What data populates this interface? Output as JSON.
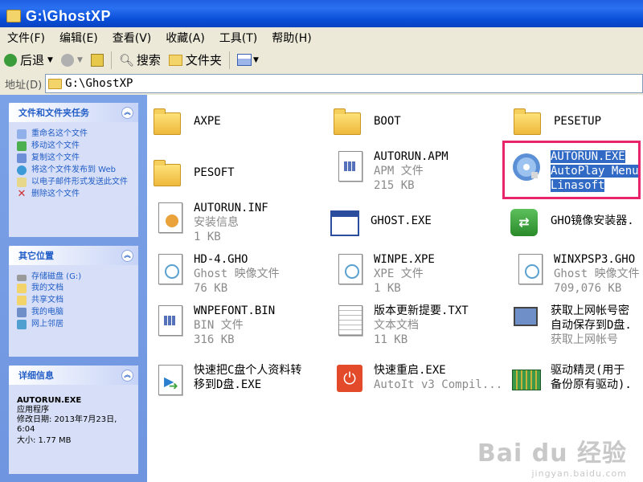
{
  "window": {
    "title": "G:\\GhostXP"
  },
  "menu": [
    {
      "label": "文件(F)"
    },
    {
      "label": "编辑(E)"
    },
    {
      "label": "查看(V)"
    },
    {
      "label": "收藏(A)"
    },
    {
      "label": "工具(T)"
    },
    {
      "label": "帮助(H)"
    }
  ],
  "toolbar": {
    "back_label": "后退",
    "search_label": "搜索",
    "folders_label": "文件夹"
  },
  "address": {
    "label": "地址(D)",
    "value": "G:\\GhostXP"
  },
  "tasks_panel": {
    "title": "文件和文件夹任务",
    "items": [
      {
        "label": "重命名这个文件"
      },
      {
        "label": "移动这个文件"
      },
      {
        "label": "复制这个文件"
      },
      {
        "label": "将这个文件发布到 Web"
      },
      {
        "label": "以电子邮件形式发送此文件"
      },
      {
        "label": "删除这个文件"
      }
    ]
  },
  "places_panel": {
    "title": "其它位置",
    "items": [
      {
        "label": "存储磁盘 (G:)"
      },
      {
        "label": "我的文档"
      },
      {
        "label": "共享文档"
      },
      {
        "label": "我的电脑"
      },
      {
        "label": "网上邻居"
      }
    ]
  },
  "details_panel": {
    "title": "详细信息",
    "name": "AUTORUN.EXE",
    "type": "应用程序",
    "modified": "修改日期: 2013年7月23日, 6:04",
    "size": "大小: 1.77 MB"
  },
  "files": [
    {
      "name": "AXPE"
    },
    {
      "name": "BOOT"
    },
    {
      "name": "PESETUP"
    },
    {
      "name": "PESOFT"
    },
    {
      "name": "AUTORUN.APM",
      "type": "APM 文件",
      "size": "215 KB"
    },
    {
      "name": "AUTORUN.EXE",
      "type": "AutoPlay Menu",
      "size": "Linasoft"
    },
    {
      "name": "AUTORUN.INF",
      "type": "安装信息",
      "size": "1 KB"
    },
    {
      "name": "GHOST.EXE"
    },
    {
      "name": "GHO镜像安装器."
    },
    {
      "name": "HD-4.GHO",
      "type": "Ghost 映像文件",
      "size": "76 KB"
    },
    {
      "name": "WINPE.XPE",
      "type": "XPE 文件",
      "size": "1 KB"
    },
    {
      "name": "WINXPSP3.GHO",
      "type": "Ghost 映像文件",
      "size": "709,076 KB"
    },
    {
      "name": "WNPEFONT.BIN",
      "type": "BIN 文件",
      "size": "316 KB"
    },
    {
      "name": "版本更新提要.TXT",
      "type": "文本文档",
      "size": "11 KB"
    },
    {
      "name": "获取上网帐号密",
      "type": "自动保存到D盘.",
      "size": "获取上网帐号"
    },
    {
      "name": "快速把C盘个人资料转",
      "type": "移到D盘.EXE"
    },
    {
      "name": "快速重启.EXE",
      "type": "AutoIt v3 Compil..."
    },
    {
      "name": "驱动精灵(用于",
      "type": "备份原有驱动)."
    }
  ],
  "watermark": {
    "brand": "Bai du 经验",
    "url": "jingyan.baidu.com"
  }
}
